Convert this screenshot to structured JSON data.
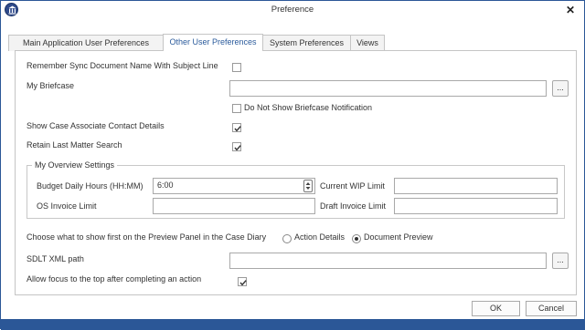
{
  "window": {
    "title": "Preference"
  },
  "tabs": [
    {
      "label": "Main Application User Preferences"
    },
    {
      "label": "Other User Preferences"
    },
    {
      "label": "System Preferences"
    },
    {
      "label": "Views"
    }
  ],
  "fields": {
    "remember_sync": {
      "label": "Remember Sync Document Name With Subject Line",
      "checked": false
    },
    "briefcase": {
      "label": "My Briefcase",
      "value": "",
      "browse_label": "..."
    },
    "no_briefcase_notif": {
      "label": "Do Not Show Briefcase Notification",
      "checked": false
    },
    "case_associate": {
      "label": "Show Case Associate Contact Details",
      "checked": true
    },
    "retain_matter": {
      "label": "Retain Last Matter Search",
      "checked": true
    }
  },
  "overview": {
    "title": "My Overview Settings",
    "budget_label": "Budget Daily Hours (HH:MM)",
    "budget_value": "6:00",
    "wip_label": "Current WIP Limit",
    "wip_value": "",
    "os_label": "OS Invoice Limit",
    "os_value": "",
    "draft_label": "Draft Invoice Limit",
    "draft_value": ""
  },
  "preview": {
    "label": "Choose what to show first on the Preview Panel in the Case Diary",
    "option_action": "Action Details",
    "option_document": "Document Preview",
    "selected": "Document Preview"
  },
  "sdlt": {
    "label": "SDLT XML path",
    "value": "",
    "browse_label": "..."
  },
  "focus": {
    "label": "Allow focus to the top after completing an action",
    "checked": true
  },
  "buttons": {
    "ok": "OK",
    "cancel": "Cancel"
  },
  "colors": {
    "accent": "#2b5797",
    "active_tab_text": "#2b5b9c"
  }
}
